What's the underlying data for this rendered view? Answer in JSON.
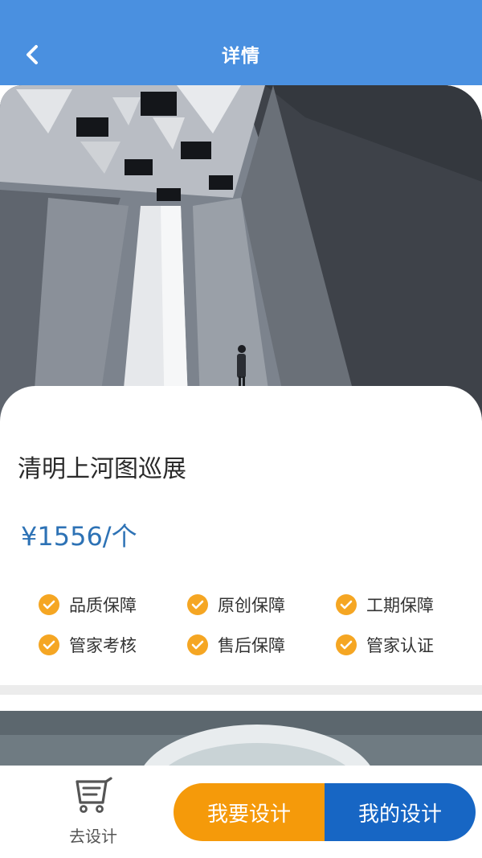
{
  "header": {
    "title": "详情",
    "back_icon": "chevron-left-icon"
  },
  "product": {
    "title": "清明上河图巡展",
    "price": "¥1556/个"
  },
  "features": [
    {
      "label": "品质保障",
      "icon": "check-circle-icon"
    },
    {
      "label": "原创保障",
      "icon": "check-circle-icon"
    },
    {
      "label": "工期保障",
      "icon": "check-circle-icon"
    },
    {
      "label": "管家考核",
      "icon": "check-circle-icon"
    },
    {
      "label": "售后保障",
      "icon": "check-circle-icon"
    },
    {
      "label": "管家认证",
      "icon": "check-circle-icon"
    }
  ],
  "bottom_bar": {
    "go_design_label": "去设计",
    "go_design_icon": "cart-icon",
    "want_design_label": "我要设计",
    "my_design_label": "我的设计"
  },
  "colors": {
    "header": "#4a90e0",
    "price": "#2d72b5",
    "check": "#f5a623",
    "btn_want": "#f59a0a",
    "btn_mine": "#1766c4"
  }
}
